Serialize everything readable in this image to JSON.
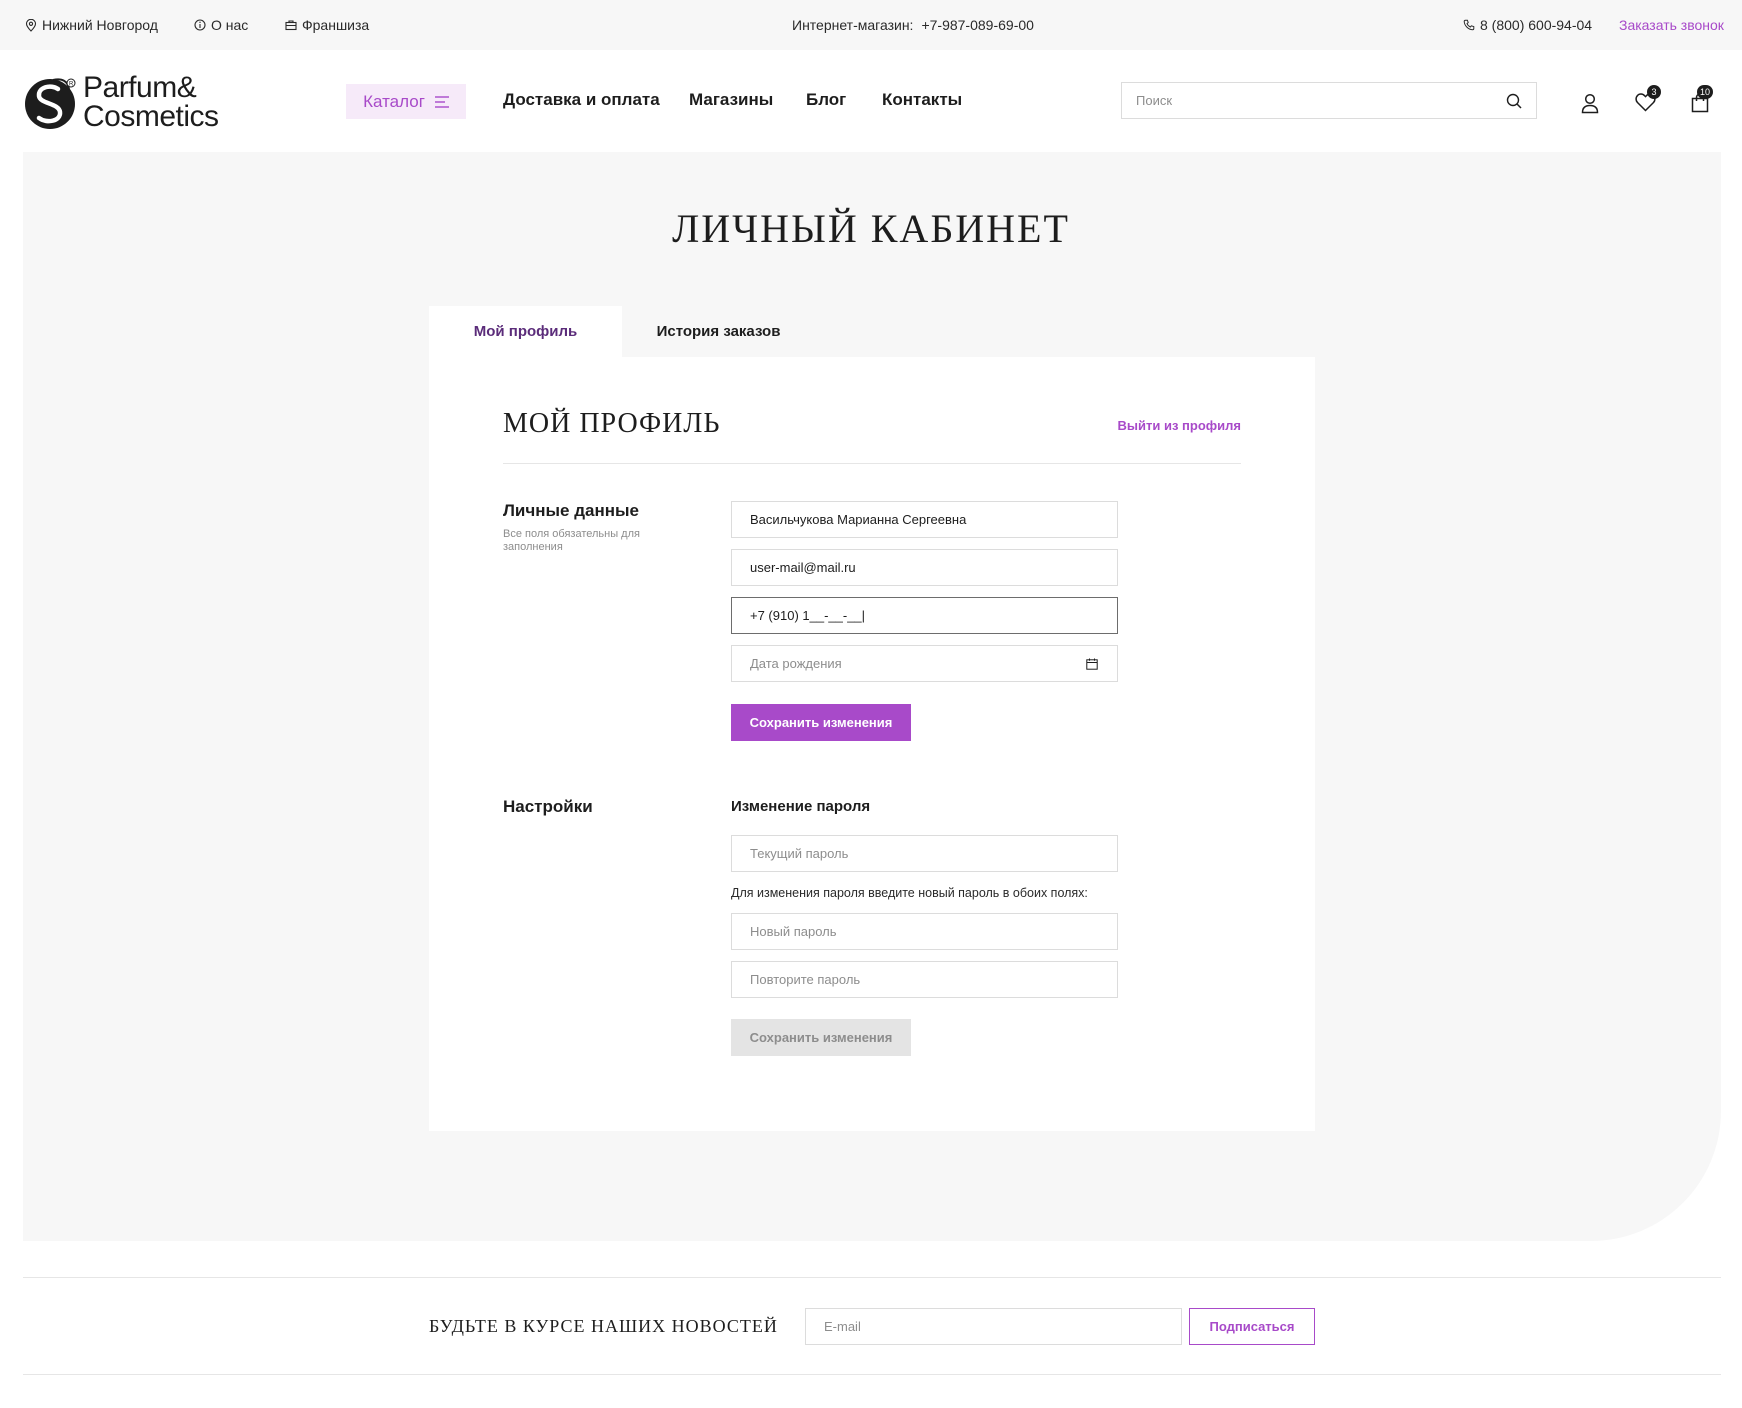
{
  "topbar": {
    "city": "Нижний Новгород",
    "about": "О нас",
    "franchise": "Франшиза",
    "shop_label": "Интернет-магазин:",
    "shop_phone": "+7-987-089-69-00",
    "hotline": "8 (800) 600-94-04",
    "callback": "Заказать звонок"
  },
  "header": {
    "logo_line1": "Parfum&",
    "logo_line2": "Cosmetics",
    "catalog": "Каталог",
    "nav": [
      "Доставка и оплата",
      "Магазины",
      "Блог",
      "Контакты"
    ],
    "search_placeholder": "Поиск",
    "favorites_count": "3",
    "cart_count": "10"
  },
  "page": {
    "title": "ЛИЧНЫЙ КАБИНЕТ",
    "tabs": [
      {
        "label": "Мой профиль",
        "active": true
      },
      {
        "label": "История заказов",
        "active": false
      }
    ]
  },
  "profile": {
    "title": "МОЙ ПРОФИЛЬ",
    "logout": "Выйти из профиля",
    "personal": {
      "label": "Личные данные",
      "note": "Все поля обязательны для заполнения",
      "name_value": "Васильчукова Марианна Сергеевна",
      "email_value": "user-mail@mail.ru",
      "phone_value": "+7 (910) 1__-__-__|",
      "birth_placeholder": "Дата рождения",
      "save": "Сохранить изменения"
    },
    "settings": {
      "label": "Настройки",
      "password_title": "Изменение пароля",
      "current_placeholder": "Текущий пароль",
      "hint": "Для изменения пароля введите новый пароль в обоих полях:",
      "new_placeholder": "Новый пароль",
      "repeat_placeholder": "Повторите пароль",
      "save": "Сохранить изменения"
    }
  },
  "newsletter": {
    "title": "БУДЬТЕ В КУРСЕ НАШИХ НОВОСТЕЙ",
    "email_placeholder": "E-mail",
    "subscribe": "Подписаться"
  },
  "colors": {
    "accent": "#a84ac9",
    "tab_active_text": "#5b2c7a",
    "background": "#f7f7f7",
    "text": "#1d1d1d"
  },
  "icons": [
    "location-pin-icon",
    "info-icon",
    "briefcase-icon",
    "phone-icon",
    "menu-lines-icon",
    "search-icon",
    "user-icon",
    "heart-icon",
    "cart-icon",
    "calendar-icon"
  ]
}
